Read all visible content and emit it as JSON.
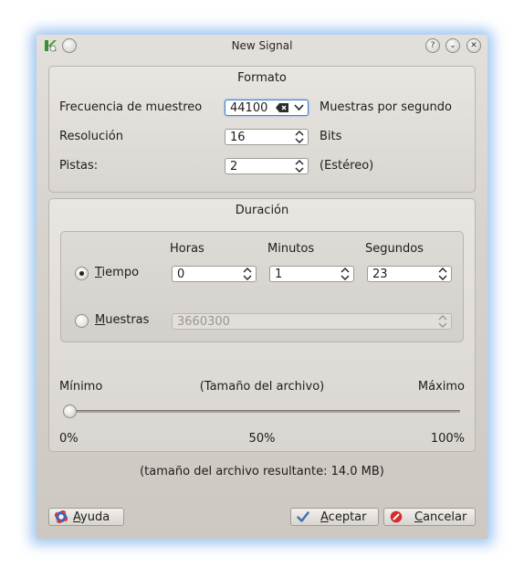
{
  "window": {
    "title": "New Signal"
  },
  "formato": {
    "title": "Formato",
    "sample_rate": {
      "label": "Frecuencia de muestreo",
      "value": "44100",
      "unit": "Muestras por segundo"
    },
    "resolution": {
      "label": "Resolución",
      "value": "16",
      "unit": "Bits"
    },
    "tracks": {
      "label": "Pistas:",
      "value": "2",
      "unit": "(Estéreo)"
    }
  },
  "duracion": {
    "title": "Duración",
    "col_hours": "Horas",
    "col_minutes": "Minutos",
    "col_seconds": "Segundos",
    "tiempo": {
      "label_first": "T",
      "label_rest": "iempo",
      "hours": "0",
      "minutes": "1",
      "seconds": "23",
      "selected": true
    },
    "muestras": {
      "label_first": "M",
      "label_rest": "uestras",
      "value": "3660300",
      "selected": false
    },
    "slider": {
      "min_label": "Mínimo",
      "center_label": "(Tamaño del archivo)",
      "max_label": "Máximo",
      "tick_0": "0%",
      "tick_50": "50%",
      "tick_100": "100%",
      "value_fraction": 0.0
    }
  },
  "result_text": "(tamaño del archivo resultante: 14.0 MB)",
  "buttons": {
    "help": {
      "first": "A",
      "rest": "yuda"
    },
    "accept": {
      "first": "A",
      "rest": "ceptar"
    },
    "cancel": {
      "first": "C",
      "rest": "ancelar"
    }
  }
}
